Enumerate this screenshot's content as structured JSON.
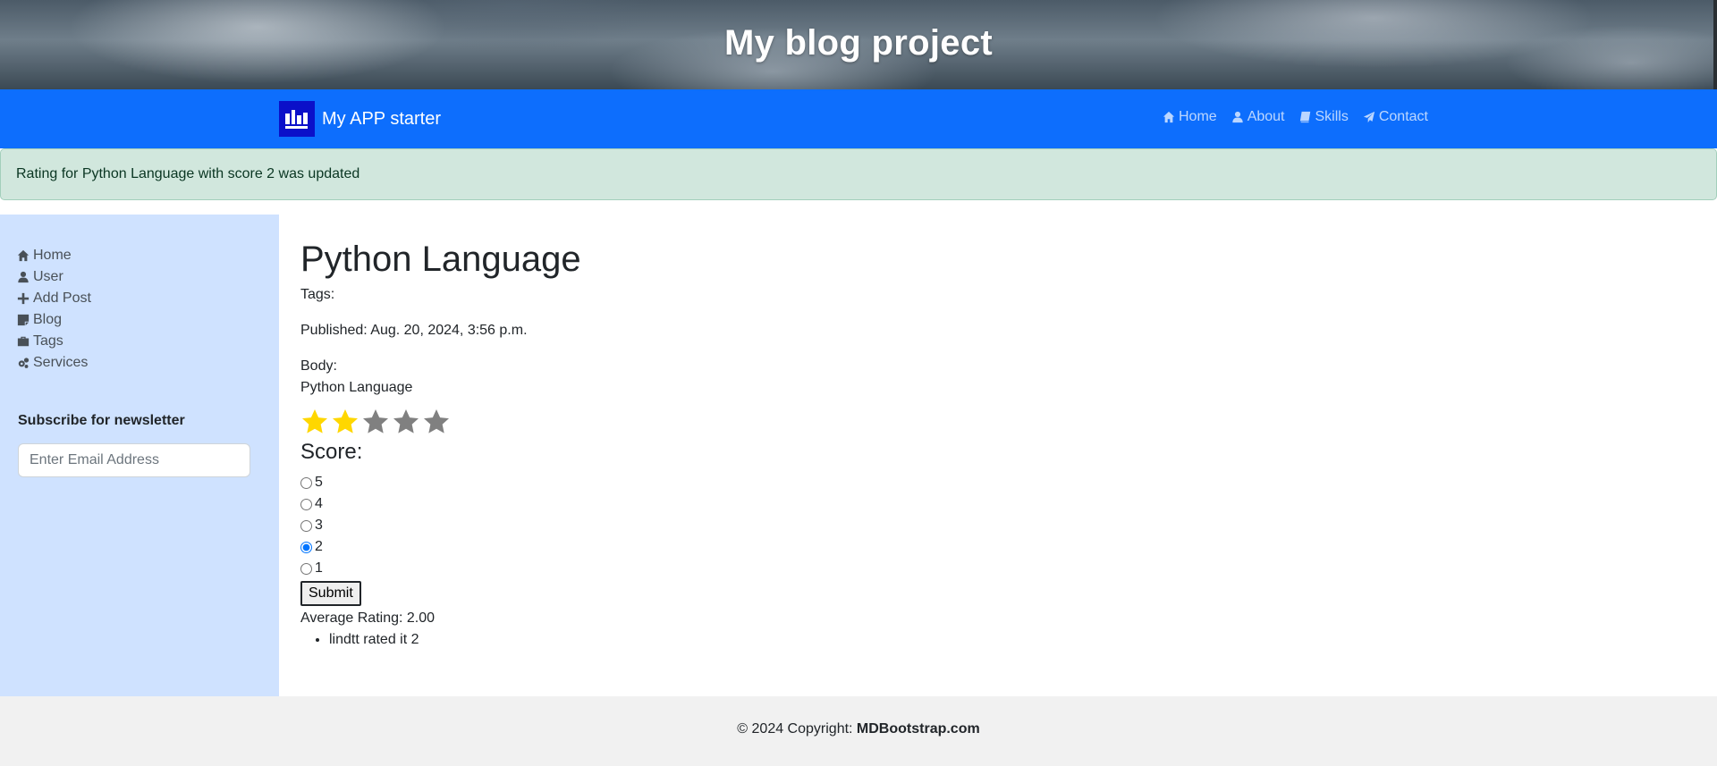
{
  "hero": {
    "title": "My blog project"
  },
  "navbar": {
    "brand": "My APP starter",
    "links": [
      {
        "label": "Home",
        "icon": "home-icon"
      },
      {
        "label": "About",
        "icon": "user-icon"
      },
      {
        "label": "Skills",
        "icon": "book-icon"
      },
      {
        "label": "Contact",
        "icon": "paper-plane-icon"
      }
    ],
    "color": "#0d6efd"
  },
  "alert": {
    "message": "Rating for Python Language with score 2 was updated"
  },
  "sidebar": {
    "items": [
      {
        "label": "Home",
        "icon": "home-icon"
      },
      {
        "label": "User",
        "icon": "user-icon"
      },
      {
        "label": "Add Post",
        "icon": "plus-icon"
      },
      {
        "label": "Blog",
        "icon": "sticky-note-icon"
      },
      {
        "label": "Tags",
        "icon": "briefcase-icon"
      },
      {
        "label": "Services",
        "icon": "gears-icon"
      }
    ],
    "newsletter": {
      "title": "Subscribe for newsletter",
      "placeholder": "Enter Email Address"
    }
  },
  "post": {
    "title": "Python Language",
    "tags_label": "Tags:",
    "published": "Published: Aug. 20, 2024, 3:56 p.m.",
    "body_label": "Body:",
    "body": "Python Language",
    "star_rating": 2,
    "star_max": 5,
    "score_heading": "Score:",
    "score_options": [
      "5",
      "4",
      "3",
      "2",
      "1"
    ],
    "selected_score": "2",
    "submit_label": "Submit",
    "average": "Average Rating: 2.00",
    "ratings": [
      "lindtt rated it 2"
    ]
  },
  "footer": {
    "copyright": "© 2024 Copyright: ",
    "brand": "MDBootstrap.com"
  }
}
